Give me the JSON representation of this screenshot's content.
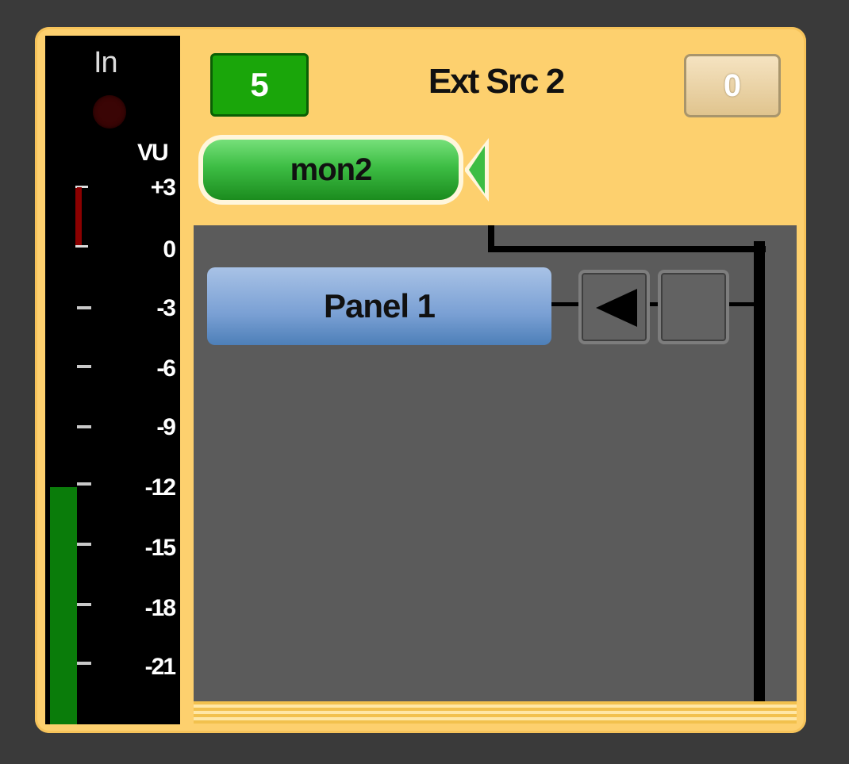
{
  "meter": {
    "in_label": "In",
    "vu_label": "VU",
    "scale": [
      "+3",
      "0",
      "-3",
      "-6",
      "-9",
      "-12",
      "-15",
      "-18",
      "-21"
    ],
    "level_db": -12,
    "peak_db": 3
  },
  "header": {
    "source_number": "5",
    "title": "Ext Src 2",
    "counter": "0"
  },
  "monitor": {
    "label": "mon2"
  },
  "workspace": {
    "panel_label": "Panel 1"
  },
  "colors": {
    "frame": "#fdd06e",
    "meter_level": "#0a7c0a",
    "source_badge": "#1aa60a",
    "monitor_button": "#3dbd44",
    "panel_button": "#7aa0d4",
    "workspace": "#5b5b5b"
  },
  "icons": {
    "peak_indicator": "peak-bracket-icon",
    "in_led": "led-icon",
    "monitor_arrow": "triangle-left-icon",
    "play_back": "triangle-left-icon",
    "stop": "square-icon"
  }
}
